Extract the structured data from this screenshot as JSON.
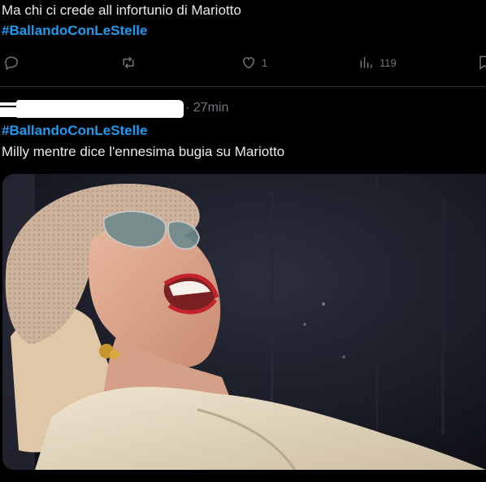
{
  "tweet1": {
    "text": "Ma chi ci crede all infortunio di Mariotto",
    "hashtag": "#BallandoConLeStelle",
    "actions": {
      "like_count": "1",
      "views_count": "119"
    }
  },
  "tweet2": {
    "timestamp": "· 27min",
    "hashtag": "#BallandoConLeStelle",
    "text": "Milly mentre dice l'ennesima bugia su Mariotto"
  },
  "icons": {
    "reply": "reply-icon",
    "retweet": "retweet-icon",
    "like": "heart-icon",
    "views": "views-icon",
    "bookmark": "bookmark-icon"
  }
}
